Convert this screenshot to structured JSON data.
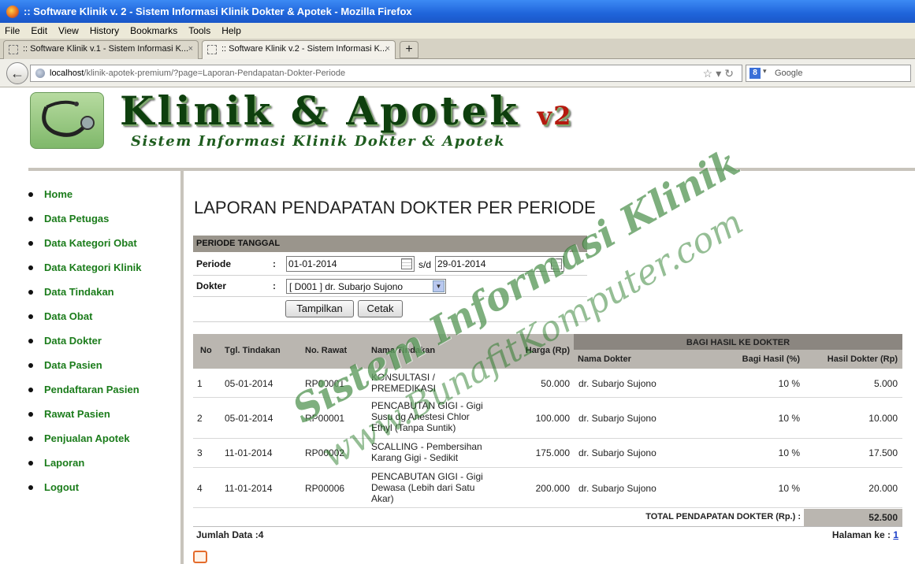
{
  "browser": {
    "window_title": ":: Software Klinik v. 2 - Sistem Informasi Klinik Dokter & Apotek - Mozilla Firefox",
    "menu": [
      "File",
      "Edit",
      "View",
      "History",
      "Bookmarks",
      "Tools",
      "Help"
    ],
    "tabs": [
      {
        "label": ":: Software Klinik v.1 - Sistem Informasi K...",
        "close": "×"
      },
      {
        "label": ":: Software Klinik v.2 - Sistem Informasi K...",
        "close": "×"
      }
    ],
    "new_tab": "+",
    "url_host": "localhost",
    "url_path": "/klinik-apotek-premium/?page=Laporan-Pendapatan-Dokter-Periode",
    "search_placeholder": "Google"
  },
  "header": {
    "title": "Klinik & Apotek",
    "version": "v2",
    "subtitle": "Sistem Informasi Klinik Dokter & Apotek"
  },
  "sidebar": {
    "items": [
      "Home",
      "Data Petugas",
      "Data Kategori Obat",
      "Data Kategori Klinik",
      "Data Tindakan",
      "Data Obat",
      "Data Dokter",
      "Data Pasien",
      "Pendaftaran Pasien",
      "Rawat Pasien",
      "Penjualan Apotek",
      "Laporan",
      "Logout"
    ]
  },
  "main": {
    "title": "LAPORAN PENDAPATAN DOKTER PER PERIODE",
    "form": {
      "header": "PERIODE TANGGAL",
      "periode_label": "Periode",
      "dokter_label": "Dokter",
      "colon": ":",
      "date_from": "01-01-2014",
      "date_sep": "s/d",
      "date_to": "29-01-2014",
      "dokter_value": "[ D001 ] dr. Subarjo Sujono",
      "btn_show": "Tampilkan",
      "btn_print": "Cetak"
    },
    "table": {
      "headers": {
        "no": "No",
        "tgl": "Tgl. Tindakan",
        "no_rawat": "No. Rawat",
        "nama_tindakan": "Nama Tindakan",
        "harga": "Harga (Rp)",
        "group": "BAGI HASIL KE DOKTER",
        "nama_dokter": "Nama Dokter",
        "bagi_hasil": "Bagi Hasil (%)",
        "hasil_dokter": "Hasil Dokter (Rp)"
      },
      "rows": [
        {
          "no": "1",
          "tgl": "05-01-2014",
          "no_rawat": "RP00001",
          "tindakan": "KONSULTASI / PREMEDIKASI",
          "harga": "50.000",
          "dokter": "dr. Subarjo Sujono",
          "persen": "10 %",
          "hasil": "5.000"
        },
        {
          "no": "2",
          "tgl": "05-01-2014",
          "no_rawat": "RP00001",
          "tindakan": "PENCABUTAN GIGI - Gigi Susu dg Anestesi Chlor Ethyl (Tanpa Suntik)",
          "harga": "100.000",
          "dokter": "dr. Subarjo Sujono",
          "persen": "10 %",
          "hasil": "10.000"
        },
        {
          "no": "3",
          "tgl": "11-01-2014",
          "no_rawat": "RP00002",
          "tindakan": "SCALLING - Pembersihan Karang Gigi - Sedikit",
          "harga": "175.000",
          "dokter": "dr. Subarjo Sujono",
          "persen": "10 %",
          "hasil": "17.500"
        },
        {
          "no": "4",
          "tgl": "11-01-2014",
          "no_rawat": "RP00006",
          "tindakan": "PENCABUTAN GIGI - Gigi Dewasa (Lebih dari Satu Akar)",
          "harga": "200.000",
          "dokter": "dr. Subarjo Sujono",
          "persen": "10 %",
          "hasil": "20.000"
        }
      ],
      "total_label": "TOTAL PENDAPATAN DOKTER (Rp.) :",
      "total_value": "52.500"
    },
    "jumlah_label": "Jumlah Data :",
    "jumlah_value": "4",
    "halaman_label": "Halaman ke :",
    "halaman_value": "1"
  },
  "watermark": {
    "line1": "Sistem Informasi Klinik",
    "line2": "www.BunafitKomputer.com"
  }
}
